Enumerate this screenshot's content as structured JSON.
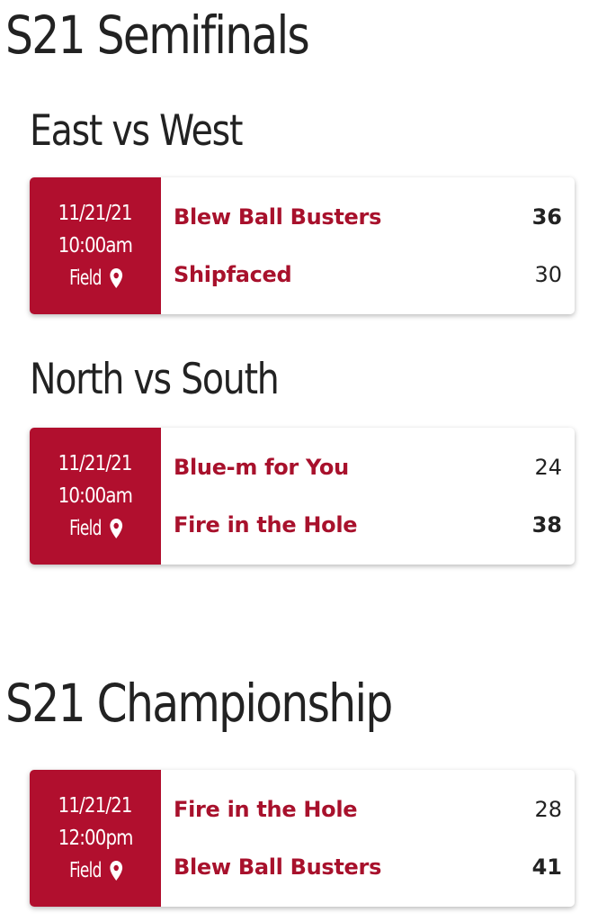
{
  "sections": [
    {
      "title": "S21 Semifinals",
      "games": [
        {
          "heading": "East vs West",
          "date": "11/21/21",
          "time": "10:00am",
          "location": "Field",
          "team1": {
            "name": "Blew Ball Busters",
            "score": "36"
          },
          "team2": {
            "name": "Shipfaced",
            "score": "30"
          }
        },
        {
          "heading": "North vs South",
          "date": "11/21/21",
          "time": "10:00am",
          "location": "Field",
          "team1": {
            "name": "Blue-m for You",
            "score": "24"
          },
          "team2": {
            "name": "Fire in the Hole",
            "score": "38"
          }
        }
      ]
    },
    {
      "title": "S21 Championship",
      "games": [
        {
          "date": "11/21/21",
          "time": "12:00pm",
          "location": "Field",
          "team1": {
            "name": "Fire in the Hole",
            "score": "28"
          },
          "team2": {
            "name": "Blew Ball Busters",
            "score": "41"
          }
        }
      ]
    }
  ],
  "colors": {
    "accent": "#b10f2e",
    "team_text": "#a8112c"
  },
  "icons": {
    "location": "map-pin-icon"
  }
}
